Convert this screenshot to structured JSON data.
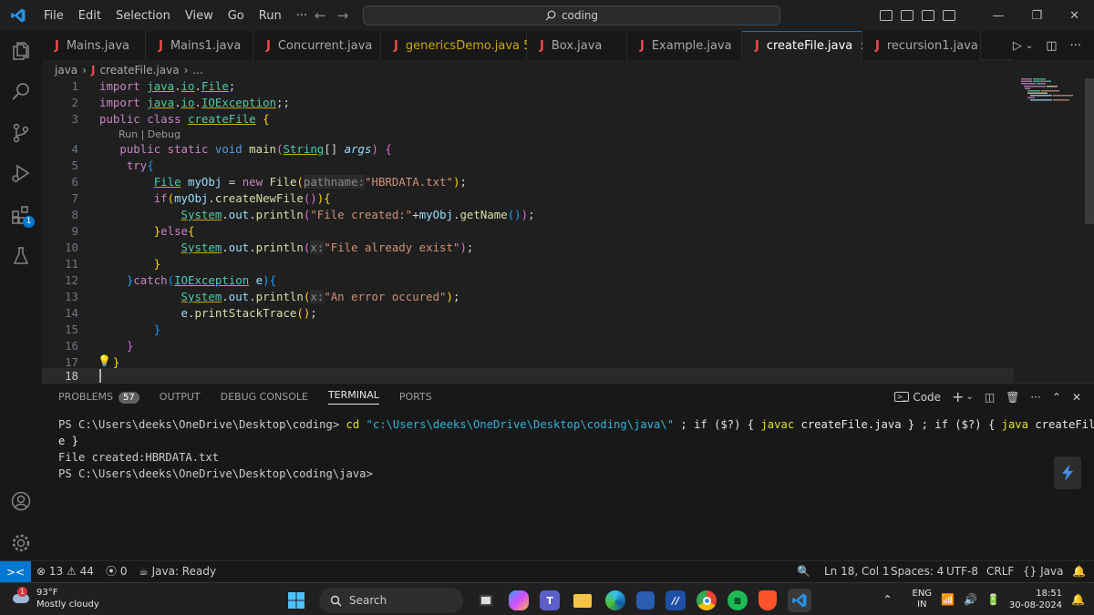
{
  "titlebar": {
    "menu": [
      "File",
      "Edit",
      "Selection",
      "View",
      "Go",
      "Run",
      "···"
    ],
    "search": "coding"
  },
  "tabs": [
    {
      "label": "Mains.java",
      "active": false
    },
    {
      "label": "Mains1.java",
      "active": false
    },
    {
      "label": "Concurrent.java",
      "active": false
    },
    {
      "label": "genericsDemo.java 5",
      "active": false,
      "warn": true
    },
    {
      "label": "Box.java",
      "active": false
    },
    {
      "label": "Example.java",
      "active": false
    },
    {
      "label": "createFile.java",
      "active": true
    },
    {
      "label": "recursion1.java",
      "active": false
    }
  ],
  "breadcrumb": {
    "folder": "java",
    "file": "createFile.java",
    "rest": "..."
  },
  "editor": {
    "codelens": "Run | Debug",
    "line_numbers": [
      "1",
      "2",
      "3",
      "4",
      "5",
      "6",
      "7",
      "8",
      "9",
      "10",
      "11",
      "12",
      "13",
      "14",
      "15",
      "16",
      "17",
      "18"
    ],
    "current_line": 18
  },
  "activity_badge": "1",
  "panel": {
    "tabs": [
      "PROBLEMS",
      "OUTPUT",
      "DEBUG CONSOLE",
      "TERMINAL",
      "PORTS"
    ],
    "problems_count": "57",
    "active_tab": "TERMINAL",
    "shell_label": "Code",
    "terminal": {
      "prompt1": "PS C:\\Users\\deeks\\OneDrive\\Desktop\\coding> ",
      "cmd_cd": "cd",
      "cmd_path": "\"c:\\Users\\deeks\\OneDrive\\Desktop\\coding\\java\\\"",
      "cmd_rest1": " ; if ($?) { ",
      "cmd_javac": "javac",
      "cmd_rest2": " createFile.java } ; if ($?) { ",
      "cmd_java": "java",
      "cmd_rest3": " createFil",
      "cmd_wrap": "e }",
      "output": "File created:HBRDATA.txt",
      "prompt2": "PS C:\\Users\\deeks\\OneDrive\\Desktop\\coding\\java>"
    }
  },
  "statusbar": {
    "errors": "13",
    "warnings": "44",
    "ports": "0",
    "java_status": "Java: Ready",
    "position": "Ln 18, Col 1",
    "spaces": "Spaces: 4",
    "encoding": "UTF-8",
    "eol": "CRLF",
    "language": "Java"
  },
  "taskbar": {
    "temp": "93°F",
    "weather": "Mostly cloudy",
    "weather_badge": "1",
    "search": "Search",
    "lang1": "ENG",
    "lang2": "IN",
    "time": "18:51",
    "date": "30-08-2024"
  },
  "colors": {
    "accent": "#0078d4",
    "java_icon": "#f14c4c",
    "warn": "#cca700"
  }
}
